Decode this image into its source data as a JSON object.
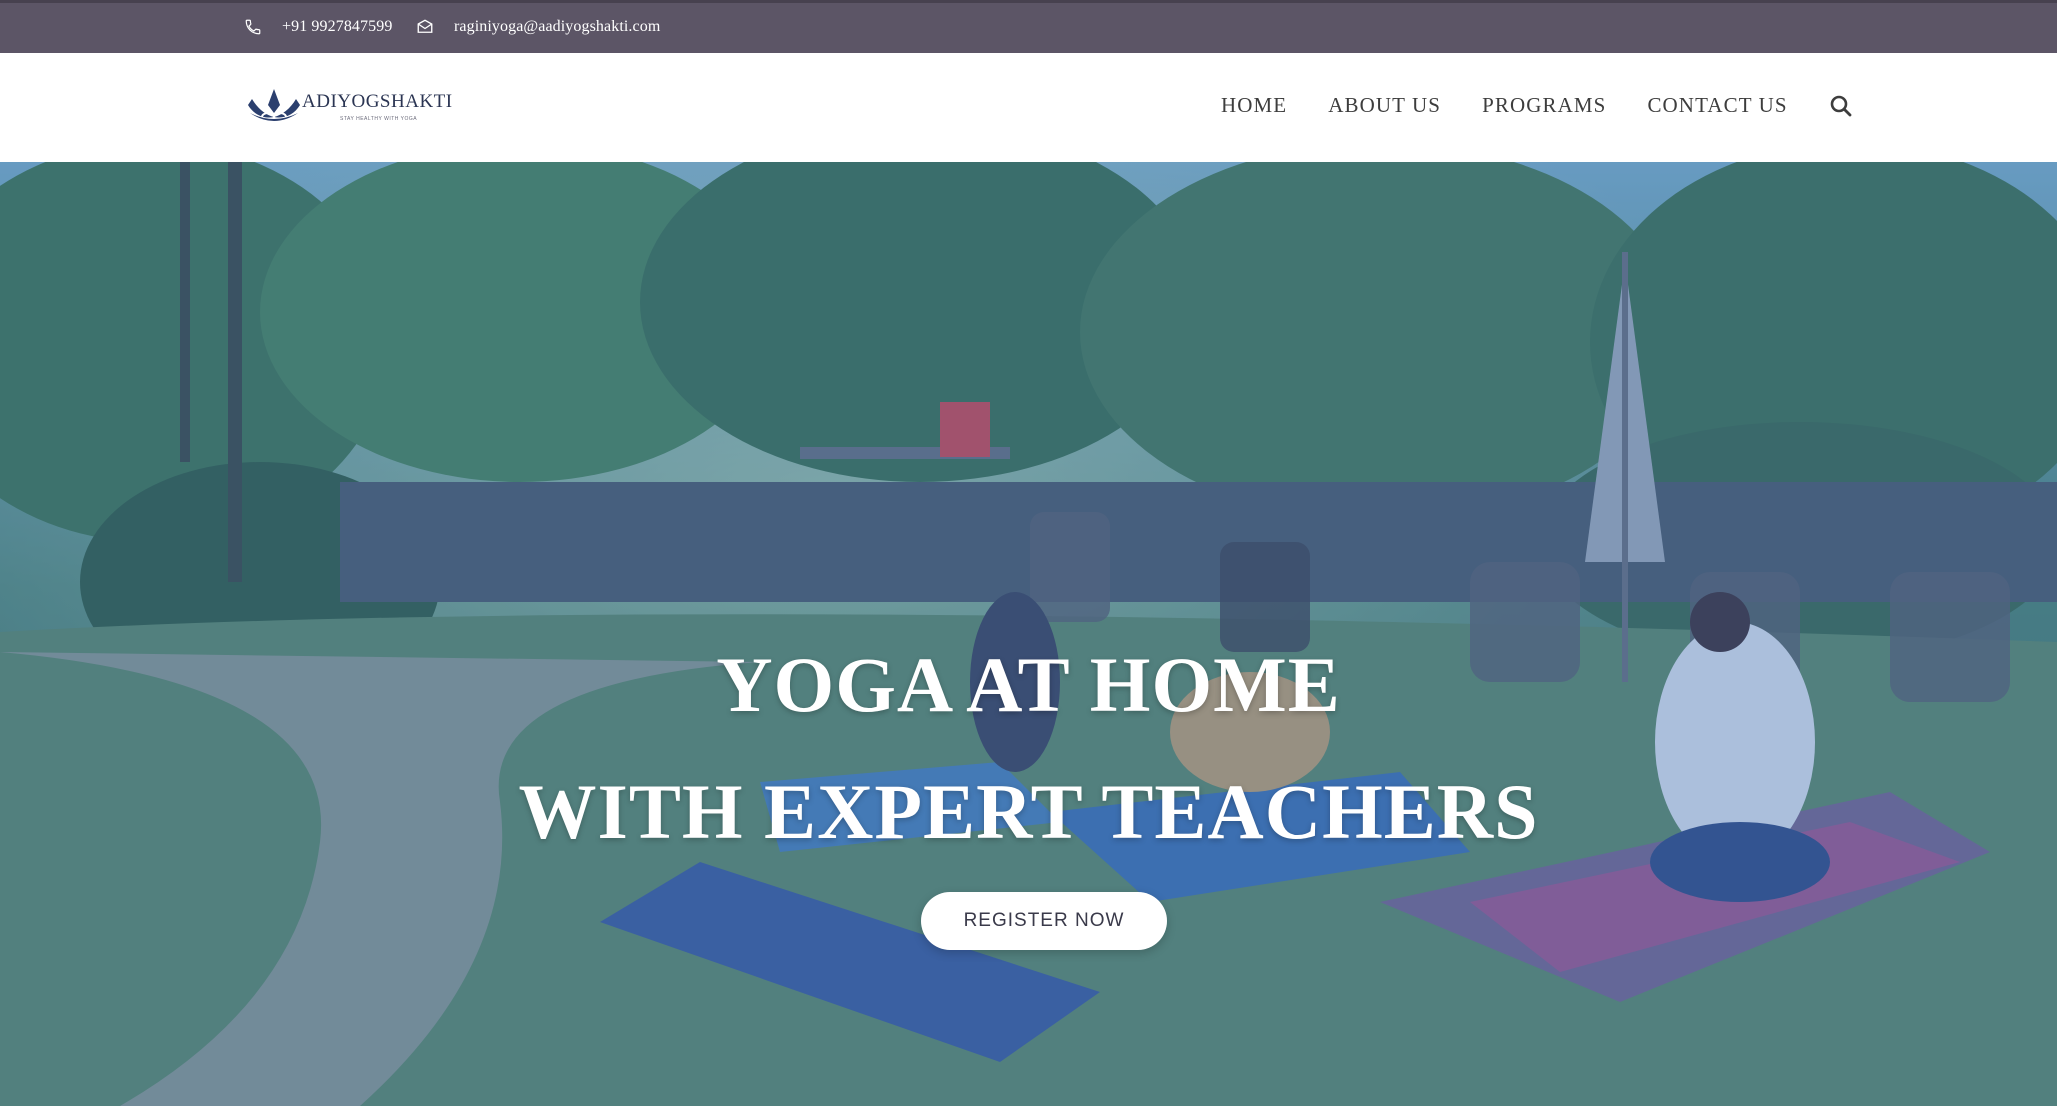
{
  "topbar": {
    "phone_icon": "phone-icon",
    "phone": "+91 9927847599",
    "email_icon": "envelope-icon",
    "email": "raginiyoga@aadiyogshakti.com",
    "bg_color": "#5c5566"
  },
  "logo": {
    "name": "ADIYOGSHAKTI",
    "tagline": "STAY HEALTHY WITH YOGA",
    "icon": "lotus-icon"
  },
  "nav": {
    "items": [
      "HOME",
      "ABOUT US",
      "PROGRAMS",
      "CONTACT US"
    ],
    "search_icon": "search-icon"
  },
  "hero": {
    "line1": "YOGA AT HOME",
    "line2": "WITH EXPERT TEACHERS",
    "cta": "REGISTER NOW",
    "overlay_color": "#3a64b4"
  }
}
